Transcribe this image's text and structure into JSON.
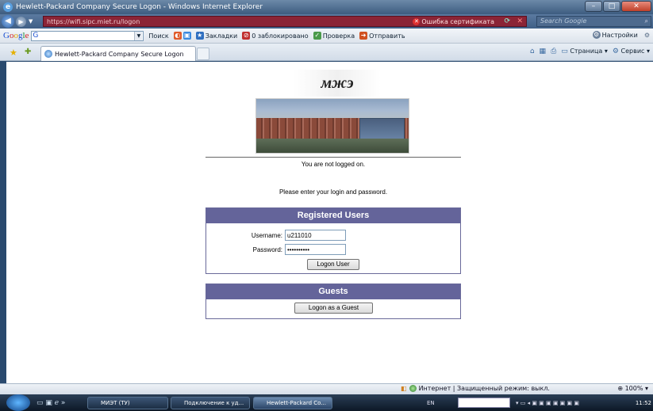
{
  "window": {
    "title": "Hewlett-Packard Company Secure Logon - Windows Internet Explorer"
  },
  "address": {
    "url": "https://wifi.sipc.miet.ru/logon",
    "cert_error": "Ошибка сертификата",
    "search_placeholder": "Search Google"
  },
  "google_toolbar": {
    "search_label": "Поиск",
    "bookmarks": "Закладки",
    "blocked": "0 заблокировано",
    "check": "Проверка",
    "send": "Отправить",
    "settings": "Настройки"
  },
  "tab": {
    "title": "Hewlett-Packard Company Secure Logon"
  },
  "commandbar": {
    "page": "Страница",
    "service": "Сервис"
  },
  "page": {
    "logo_text": "мжэ",
    "not_logged": "You are not logged on.",
    "prompt": "Please enter your login and password.",
    "registered_header": "Registered Users",
    "username_label": "Username:",
    "username_value": "u211010",
    "password_label": "Password:",
    "password_value": "••••••••••",
    "logon_button": "Logon User",
    "guests_header": "Guests",
    "guest_button": "Logon as a Guest"
  },
  "statusbar": {
    "zone": "Интернет | Защищенный режим: выкл.",
    "zoom": "100%"
  },
  "taskbar": {
    "items": [
      "МИЭТ (ТУ)",
      "Подключение к уд...",
      "Hewlett-Packard Co..."
    ],
    "lang": "EN",
    "clock": "11:52"
  }
}
